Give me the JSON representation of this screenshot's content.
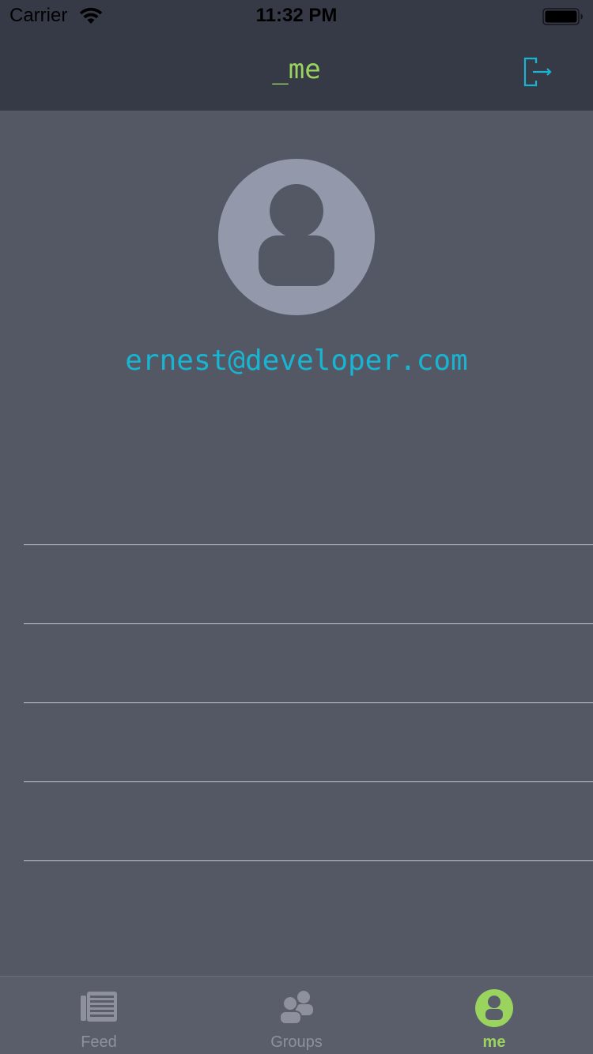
{
  "status_bar": {
    "carrier": "Carrier",
    "time": "11:32 PM",
    "icons": [
      "wifi-icon",
      "battery-icon"
    ]
  },
  "nav": {
    "title": "_me",
    "right_icon": "logout-icon",
    "title_color": "#9ad45e",
    "accent_color": "#18b5d3"
  },
  "profile": {
    "avatar_icon": "person-icon",
    "email": "ernest@developer.com"
  },
  "list": {
    "rows": [
      "",
      "",
      "",
      "",
      ""
    ]
  },
  "tab_bar": {
    "tabs": [
      {
        "label": "Feed",
        "icon": "newspaper-icon",
        "selected": false
      },
      {
        "label": "Groups",
        "icon": "group-icon",
        "selected": false
      },
      {
        "label": "me",
        "icon": "person-icon",
        "selected": true
      }
    ],
    "active_color": "#9ad45e",
    "inactive_color": "#8e919c"
  },
  "colors": {
    "background": "#545865",
    "bar_background": "#363946"
  }
}
